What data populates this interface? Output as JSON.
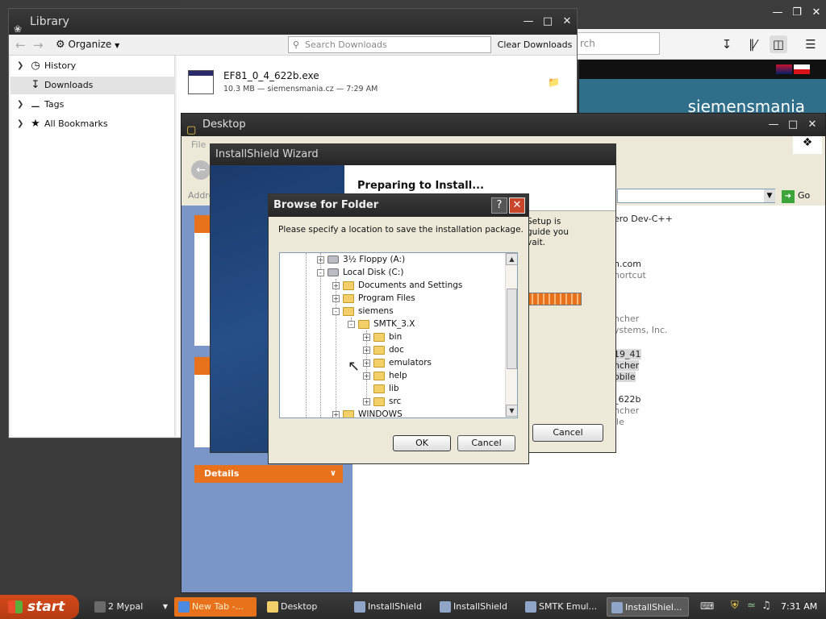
{
  "library": {
    "title": "Library",
    "organize": "Organize",
    "search_placeholder": "Search Downloads",
    "clear_button": "Clear Downloads",
    "sidebar": [
      {
        "label": "History",
        "icon": "clock-icon"
      },
      {
        "label": "Downloads",
        "icon": "download-icon"
      },
      {
        "label": "Tags",
        "icon": "tag-icon"
      },
      {
        "label": "All Bookmarks",
        "icon": "star-icon"
      }
    ],
    "download": {
      "name": "EF81_0_4_622b.exe",
      "meta": "10.3 MB — siemensmania.cz — 7:29 AM"
    }
  },
  "firefox_bg": {
    "search_placeholder": "rch",
    "site_logo": "siemensmania"
  },
  "desktop": {
    "title": "Desktop",
    "menu_file": "File",
    "address_label": "Addre",
    "go": "Go",
    "details": "Details",
    "files": [
      "ero Dev-C++",
      "n.com",
      "hortcut",
      "ncher",
      "ystems, Inc.",
      "19_41",
      "ncher",
      "obile",
      "_622b",
      "ncher",
      "ile"
    ]
  },
  "install": {
    "title": "InstallShield Wizard",
    "heading": "Preparing to Install...",
    "body": [
      "Setup is",
      "guide you",
      "vait."
    ],
    "cancel": "Cancel"
  },
  "browse": {
    "title": "Browse for Folder",
    "help": "?",
    "prompt": "Please specify a location to save the installation package.",
    "tree": [
      {
        "label": "3½ Floppy (A:)",
        "level": 0,
        "toggle": "+",
        "kind": "floppy"
      },
      {
        "label": "Local Disk (C:)",
        "level": 0,
        "toggle": "-",
        "kind": "disk"
      },
      {
        "label": "Documents and Settings",
        "level": 1,
        "toggle": "+",
        "kind": "folder"
      },
      {
        "label": "Program Files",
        "level": 1,
        "toggle": "+",
        "kind": "folder"
      },
      {
        "label": "siemens",
        "level": 1,
        "toggle": "-",
        "kind": "folder"
      },
      {
        "label": "SMTK_3.X",
        "level": 2,
        "toggle": "-",
        "kind": "folder"
      },
      {
        "label": "bin",
        "level": 3,
        "toggle": "+",
        "kind": "folder"
      },
      {
        "label": "doc",
        "level": 3,
        "toggle": "+",
        "kind": "folder"
      },
      {
        "label": "emulators",
        "level": 3,
        "toggle": "+",
        "kind": "folder"
      },
      {
        "label": "help",
        "level": 3,
        "toggle": "+",
        "kind": "folder"
      },
      {
        "label": "lib",
        "level": 3,
        "toggle": "",
        "kind": "folder"
      },
      {
        "label": "src",
        "level": 3,
        "toggle": "+",
        "kind": "folder"
      },
      {
        "label": "WINDOWS",
        "level": 1,
        "toggle": "+",
        "kind": "folder"
      }
    ],
    "ok": "OK",
    "cancel": "Cancel"
  },
  "taskbar": {
    "start": "start",
    "items": [
      {
        "label": "2 Mypal",
        "color": "#6a6a6a",
        "state": "normal"
      },
      {
        "label": "New Tab -...",
        "color": "#4a8be0",
        "state": "highlight"
      },
      {
        "label": "Desktop",
        "color": "#f2cf68",
        "state": "normal"
      },
      {
        "label": "InstallShield",
        "color": "#8fa6c8",
        "state": "normal"
      },
      {
        "label": "InstallShield",
        "color": "#8fa6c8",
        "state": "normal"
      },
      {
        "label": "SMTK Emul...",
        "color": "#8fa6c8",
        "state": "normal"
      },
      {
        "label": "InstallShiel...",
        "color": "#8fa6c8",
        "state": "active"
      }
    ],
    "clock": "7:31 AM"
  }
}
